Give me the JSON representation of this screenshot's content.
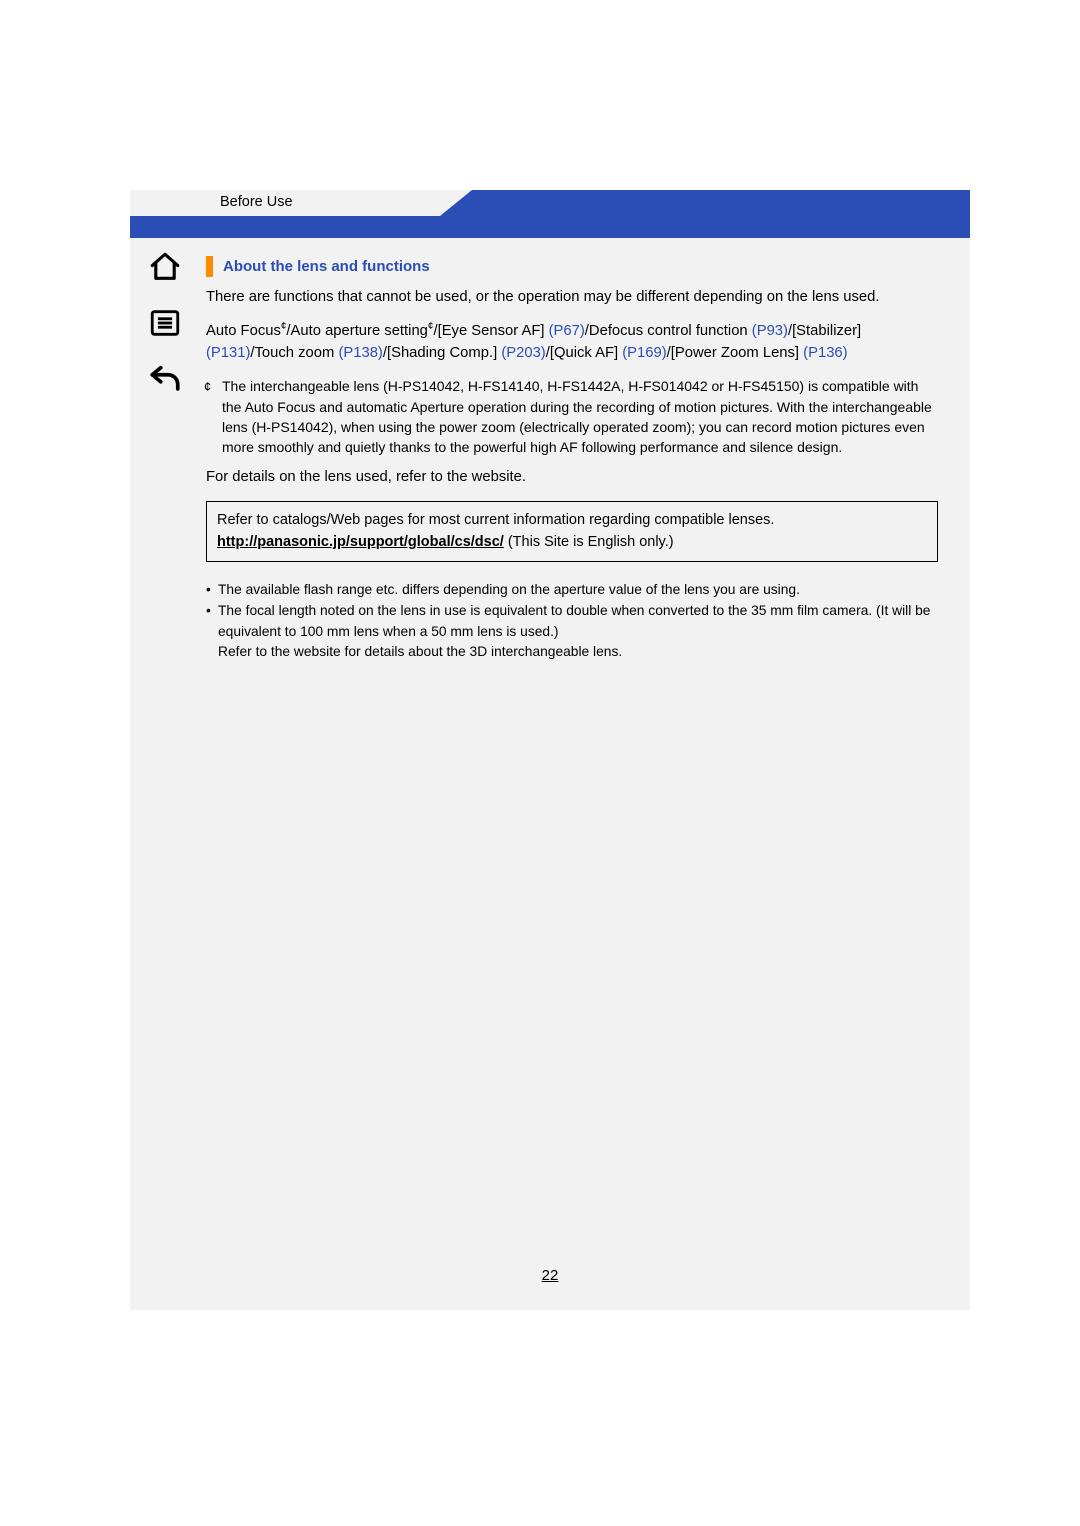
{
  "header": {
    "breadcrumb": "Before Use"
  },
  "sidebar": {
    "home_label": "home-icon",
    "toc_label": "toc-icon",
    "back_label": "back-icon"
  },
  "section": {
    "title": "About the lens and functions"
  },
  "p1": "There are functions that cannot be used, or the operation may be different depending on the lens used.",
  "p2_parts": {
    "t0": "Auto Focus",
    "sup1": "¢",
    "t1": "/Auto aperture setting",
    "sup2": "¢",
    "t2": "/[Eye Sensor AF] ",
    "l1": "(P67)",
    "t3": "/Defocus control function ",
    "l2": "(P93)",
    "t4": "/[Stabilizer] ",
    "l3": "(P131)",
    "t5": "/Touch zoom ",
    "l4": "(P138)",
    "t6": "/[Shading Comp.] ",
    "l5": "(P203)",
    "t7": "/[Quick AF] ",
    "l6": "(P169)",
    "t8": "/[Power Zoom Lens] ",
    "l7": "(P136)"
  },
  "footnote": {
    "mark": "¢",
    "text": "The interchangeable lens (H-PS14042, H-FS14140, H-FS1442A, H-FS014042 or H-FS45150) is compatible with the Auto Focus and automatic Aperture operation during the recording of motion pictures. With the interchangeable lens (H-PS14042), when using the power zoom (electrically operated zoom); you can record motion pictures even more smoothly and quietly thanks to the powerful high AF following performance and silence design."
  },
  "p3": "For details on the lens used, refer to the website.",
  "box": {
    "line1": "Refer to catalogs/Web pages for most current information regarding compatible lenses.",
    "url": "http://panasonic.jp/support/global/cs/dsc/",
    "line2_tail": " (This Site is English only.)"
  },
  "notes": {
    "n1": "The available flash range etc. differs depending on the aperture value of the lens you are using.",
    "n2a": "The focal length noted on the lens in use is equivalent to double when converted to the 35 mm film camera. (It will be equivalent to 100 mm lens when a 50 mm lens is used.)",
    "n2b": "Refer to the website for details about the 3D interchangeable lens."
  },
  "page_number": "22"
}
